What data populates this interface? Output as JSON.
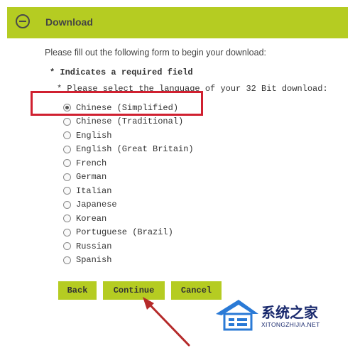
{
  "header": {
    "title": "Download"
  },
  "form": {
    "intro": "Please fill out the following form to begin your download:",
    "required_note": "* Indicates a required field",
    "select_label": "* Please select the language of your 32 Bit download:",
    "languages": [
      {
        "label": "Chinese (Simplified)",
        "checked": true
      },
      {
        "label": "Chinese (Traditional)",
        "checked": false
      },
      {
        "label": "English",
        "checked": false
      },
      {
        "label": "English (Great Britain)",
        "checked": false
      },
      {
        "label": "French",
        "checked": false
      },
      {
        "label": "German",
        "checked": false
      },
      {
        "label": "Italian",
        "checked": false
      },
      {
        "label": "Japanese",
        "checked": false
      },
      {
        "label": "Korean",
        "checked": false
      },
      {
        "label": "Portuguese (Brazil)",
        "checked": false
      },
      {
        "label": "Russian",
        "checked": false
      },
      {
        "label": "Spanish",
        "checked": false
      }
    ]
  },
  "buttons": {
    "back": "Back",
    "continue": "Continue",
    "cancel": "Cancel"
  },
  "watermark": {
    "brand": "系统之家",
    "site": "XITONGZHIJIA.NET"
  },
  "colors": {
    "accent": "#b5cc22",
    "highlight": "#d02030",
    "arrow": "#b52a2a",
    "watermark": "#1a2a6e"
  }
}
